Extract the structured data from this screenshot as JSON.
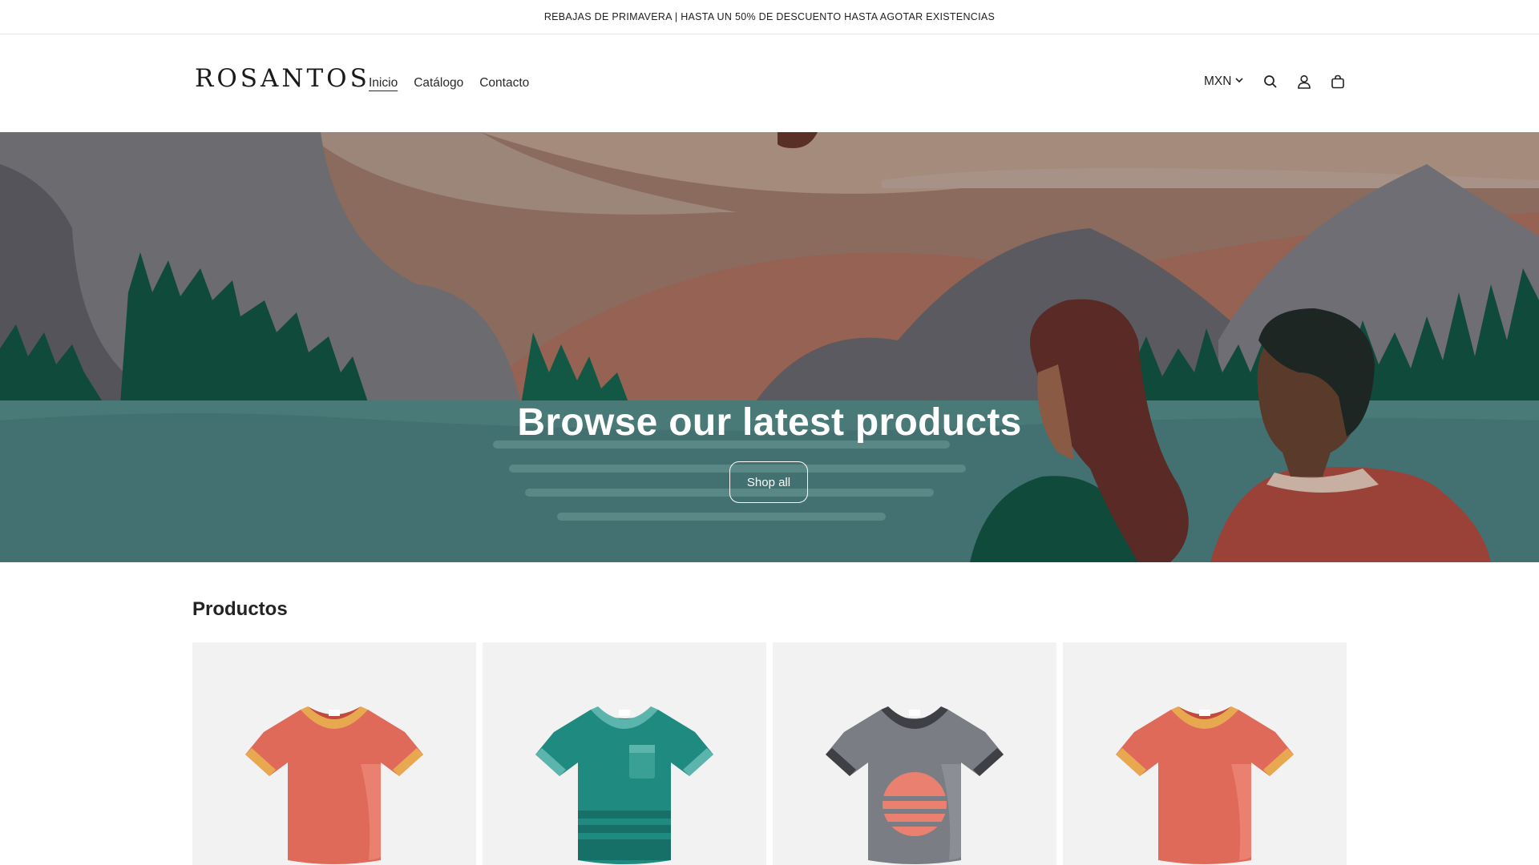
{
  "announcement": {
    "text": "REBAJAS DE PRIMAVERA | HASTA UN 50% DE DESCUENTO HASTA AGOTAR EXISTENCIAS"
  },
  "header": {
    "logo": "ROSANTOS",
    "nav": [
      {
        "label": "Inicio",
        "active": true
      },
      {
        "label": "Catálogo",
        "active": false
      },
      {
        "label": "Contacto",
        "active": false
      }
    ],
    "currency": "MXN",
    "icons": [
      "search-icon",
      "account-icon",
      "cart-icon"
    ]
  },
  "hero": {
    "title": "Browse our latest products",
    "button_label": "Shop all"
  },
  "products": {
    "title": "Productos",
    "items": [
      {
        "name": "tshirt-red",
        "colors": {
          "body": "#e06a5a",
          "trim": "#e8a850",
          "shade": "#ea8070"
        }
      },
      {
        "name": "tshirt-teal",
        "colors": {
          "body": "#1f8a80",
          "trim": "#5cb5ac",
          "shade": "#177068"
        }
      },
      {
        "name": "tshirt-gray",
        "colors": {
          "body": "#7a7d83",
          "trim": "#3e4045",
          "shade": "#8b8e94"
        }
      },
      {
        "name": "tshirt-red",
        "colors": {
          "body": "#e06a5a",
          "trim": "#e8a850",
          "shade": "#ea8070"
        }
      }
    ]
  }
}
